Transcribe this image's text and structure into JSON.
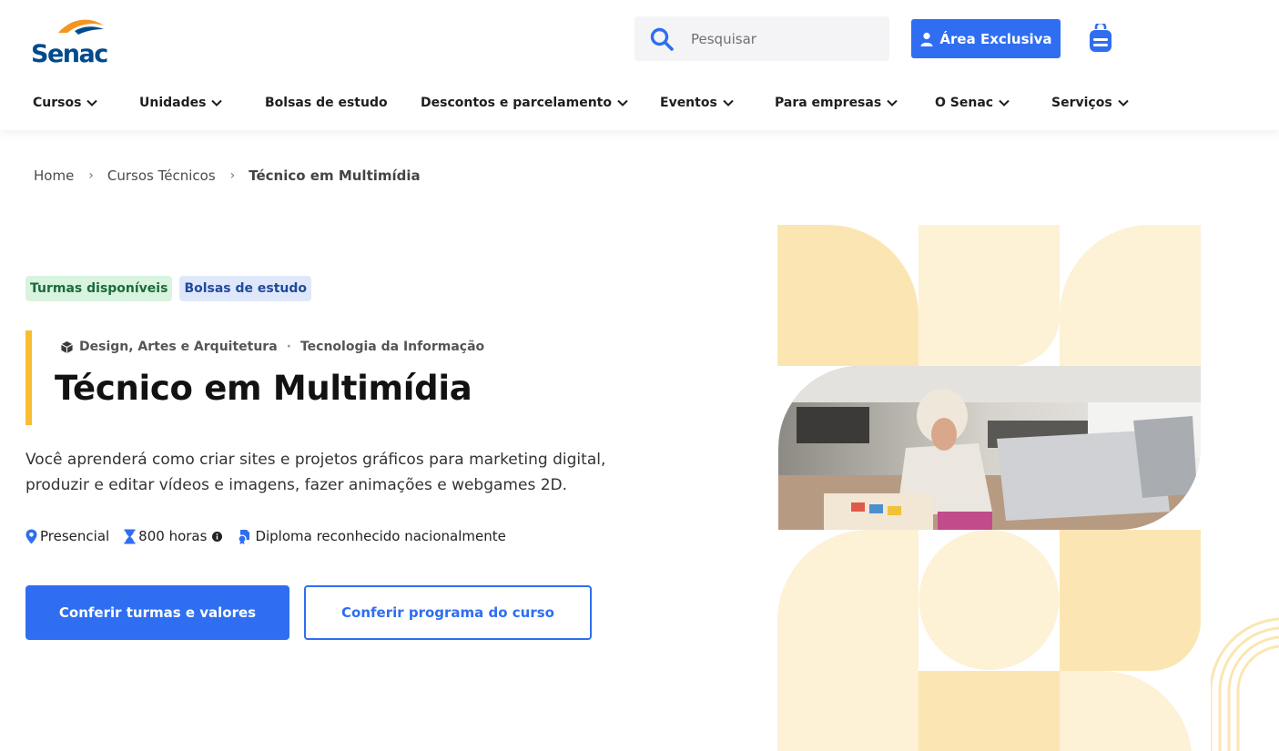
{
  "brand": {
    "logo_text": "Senac",
    "primary_color": "#2f6ef0",
    "logo_blue": "#004a8d",
    "logo_orange": "#f7941d",
    "accent_yellow": "#f7bd33"
  },
  "header": {
    "search_placeholder": "Pesquisar",
    "area_exclusiva_label": "Área Exclusiva",
    "icons": {
      "search": "search-icon",
      "user": "user-icon",
      "bag": "backpack-icon"
    }
  },
  "nav": {
    "items": [
      {
        "label": "Cursos",
        "dropdown": true
      },
      {
        "label": "Unidades",
        "dropdown": true
      },
      {
        "label": "Bolsas de estudo",
        "dropdown": false
      },
      {
        "label": "Descontos e parcelamento",
        "dropdown": true
      },
      {
        "label": "Eventos",
        "dropdown": true
      },
      {
        "label": "Para empresas",
        "dropdown": true
      },
      {
        "label": "O Senac",
        "dropdown": true
      },
      {
        "label": "Serviços",
        "dropdown": true
      }
    ]
  },
  "breadcrumb": {
    "items": [
      "Home",
      "Cursos Técnicos",
      "Técnico em Multimídia"
    ]
  },
  "course": {
    "tags": [
      "Turmas disponíveis",
      "Bolsas de estudo"
    ],
    "areas": [
      "Design, Artes e Arquitetura",
      "Tecnologia da Informação"
    ],
    "title": "Técnico em Multimídia",
    "description": "Você aprenderá como criar sites e projetos gráficos para marketing digital, produzir e editar vídeos e imagens, fazer animações e webgames 2D.",
    "features": {
      "modality": "Presencial",
      "hours": "800 horas",
      "diploma": "Diploma reconhecido nacionalmente"
    },
    "cta_primary": "Conferir turmas e valores",
    "cta_secondary": "Conferir programa do curso"
  }
}
